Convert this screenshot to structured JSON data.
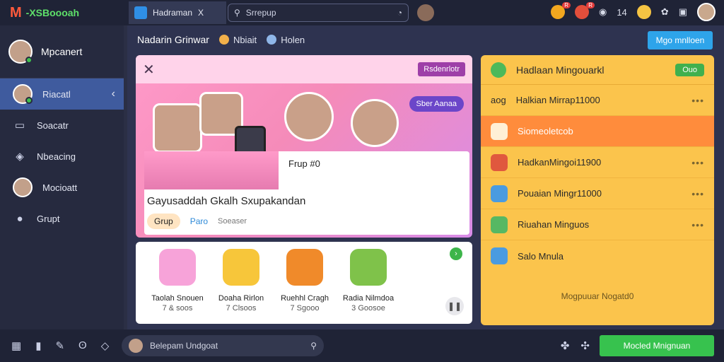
{
  "app": {
    "logo_letter": "M",
    "logo_text": "-XSBoooah"
  },
  "tab": {
    "label": "Hadraman",
    "close": "X"
  },
  "search": {
    "placeholder": "Srrepup"
  },
  "topbar": {
    "badge1": "R",
    "badge2": "R",
    "count": "14"
  },
  "sidebar": {
    "profile_name": "Mpcanert",
    "items": [
      {
        "label": "Riacatl",
        "active": true
      },
      {
        "label": "Soacatr"
      },
      {
        "label": "Nbeacing"
      },
      {
        "label": "Mocioatt"
      },
      {
        "label": "Grupt"
      }
    ]
  },
  "main": {
    "title": "Nadarin Grinwar",
    "sub1": "Nbiait",
    "sub2": "Holen",
    "top_button": "Mgo mnlloen"
  },
  "feature": {
    "pill": "Rsdenrlotr",
    "tag": "Sber Aanaa",
    "frup": "Frup #0",
    "title": "Gayusaddah Gkalh Sxupakandan",
    "chip1": "Grup",
    "chip2": "Paro",
    "chip3": "Soeaser"
  },
  "gifts": [
    {
      "name": "Taolah Snouen",
      "price": "7 & soos"
    },
    {
      "name": "Doaha Rirlon",
      "price": "7 Clsoos"
    },
    {
      "name": "Ruehhl Cragh",
      "price": "7 Sgooo"
    },
    {
      "name": "Radia Nilmdoa",
      "price": "3 Goosoe"
    }
  ],
  "panel": {
    "title": "Hadlaan Mingouarkl",
    "ok": "Ouo",
    "rows": [
      {
        "label": "Halkian Mirrap11000",
        "prefix": "aog"
      },
      {
        "label": "Siomeoletcob",
        "highlight": true
      },
      {
        "label": "HadkanMingoi11900"
      },
      {
        "label": "Pouaian Mingr11000"
      },
      {
        "label": "Riuahan Minguos"
      },
      {
        "label": "Salo Mnula"
      }
    ],
    "footer": "Mogpuuar Nogatd0"
  },
  "bottom": {
    "input_placeholder": "Belepam Undgoat",
    "button": "Mocled Mnignuan"
  }
}
